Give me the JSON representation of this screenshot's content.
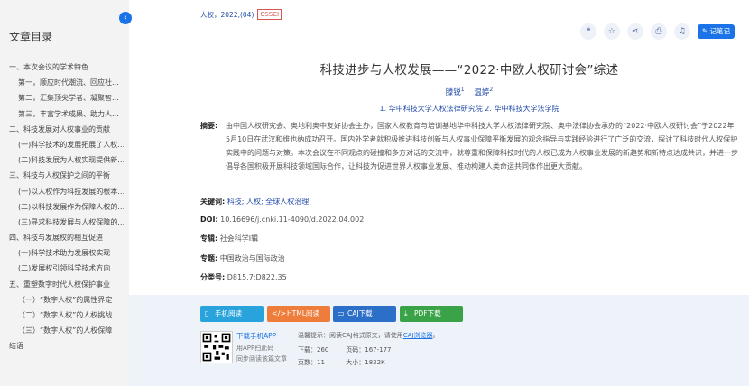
{
  "sidebar": {
    "title": "文章目录",
    "items": [
      {
        "label": "一、本次会议的学术特色",
        "level": 1
      },
      {
        "label": "第一，顺应时代潮流、回应社…",
        "level": 2
      },
      {
        "label": "第二，汇集顶尖学者、凝聚智…",
        "level": 2
      },
      {
        "label": "第三，丰富学术成果、助力人…",
        "level": 2
      },
      {
        "label": "二、科技发展对人权事业的贡献",
        "level": 1
      },
      {
        "label": "(一)科学技术的发展拓展了人权…",
        "level": 2
      },
      {
        "label": "(二)科技发展为人权实现提供新…",
        "level": 2
      },
      {
        "label": "三、科技与人权保护之间的平衡",
        "level": 1
      },
      {
        "label": "(一)以人权作为科技发展的根本…",
        "level": 2
      },
      {
        "label": "(二)以科技发展作为保障人权的…",
        "level": 2
      },
      {
        "label": "(三)寻求科技发展与人权保障的…",
        "level": 2
      },
      {
        "label": "四、科技与发展权的相互促进",
        "level": 1
      },
      {
        "label": "(一)科学技术助力发展权实现",
        "level": 2
      },
      {
        "label": "(二)发展权引领科学技术方向",
        "level": 2
      },
      {
        "label": "五、重塑数字时代人权保护事业",
        "level": 1
      },
      {
        "label": "（一）“数字人权”的属性界定",
        "level": 2
      },
      {
        "label": "（二）“数字人权”的人权挑战",
        "level": 2
      },
      {
        "label": "（三）“数字人权”的人权保障",
        "level": 2
      },
      {
        "label": "结语",
        "level": 1
      }
    ],
    "collapse_icon": "chevron-left-icon"
  },
  "meta": {
    "journal": "人权，2022,(04)",
    "badge": "CSSCI"
  },
  "toolbar": {
    "icons": [
      "quote-icon",
      "star-icon",
      "share-icon",
      "print-icon",
      "bell-icon"
    ],
    "note_label": "记笔记"
  },
  "article": {
    "title": "科技进步与人权发展——“2022·中欧人权研讨会”综述",
    "authors": [
      {
        "name": "滕锐",
        "sup": "1"
      },
      {
        "name": "温婷",
        "sup": "2"
      }
    ],
    "affiliations": "1. 华中科技大学人权法律研究院   2. 华中科技大学法学院"
  },
  "fields": {
    "abstract_label": "摘要:",
    "abstract": "由中国人权研究会、奥地利奥中友好协会主办，国家人权教育与培训基地华中科技大学人权法律研究院、奥中法律协会承办的“2022·中欧人权研讨会”于2022年5月10日在武汉和维也纳成功召开。国内外学者就积极推进科技创新与人权事业保障平衡发展的观念指导与实践经验进行了广泛的交流，探讨了科技时代人权保护实践中的问题与对策。本次会议在不同观点的碰撞和多方对话的交流中，就尊重和保障科技时代的人权已成为人权事业发展的新趋势和新特点达成共识，并进一步倡导各国积极开展科技领域国际合作，让科技为促进世界人权事业发展、推动构建人类命运共同体作出更大贡献。",
    "keywords_label": "关键词:",
    "keywords": [
      "科技;",
      "人权;",
      "全球人权治理;"
    ],
    "doi_label": "DOI:",
    "doi": "10.16696/j.cnki.11-4090/d.2022.04.002",
    "series_label": "专辑:",
    "series": "社会科学Ⅰ辑",
    "topic_label": "专题:",
    "topic": "中国政治与国际政治",
    "class_label": "分类号:",
    "class": "D815.7;D822.35"
  },
  "downloads": {
    "mobile": "手机阅读",
    "html": "HTML阅读",
    "caj": "CAJ下载",
    "pdf": "PDF下载",
    "app_link": "下载手机APP",
    "app_text1": "用APP扫此码",
    "app_text2": "同步阅读该篇文章",
    "tip_prefix": "温馨提示：阅读CAJ格式原文，请使用",
    "tip_link": "CAJ浏览器",
    "tip_suffix": "。",
    "stats": {
      "downloads_label": "下载：",
      "downloads": "260",
      "pages_label": "页码：",
      "pages": "167-177",
      "pagecount_label": "页数：",
      "pagecount": "11",
      "size_label": "大小：",
      "size": "1832K"
    }
  },
  "colors": {
    "accent": "#1a73e8",
    "link": "#1f4aa8",
    "cssci": "#d9534f",
    "btn_mobile": "#29a3dc",
    "btn_html": "#ee7d3b",
    "btn_caj": "#2b6fc9",
    "btn_pdf": "#3aa347"
  }
}
